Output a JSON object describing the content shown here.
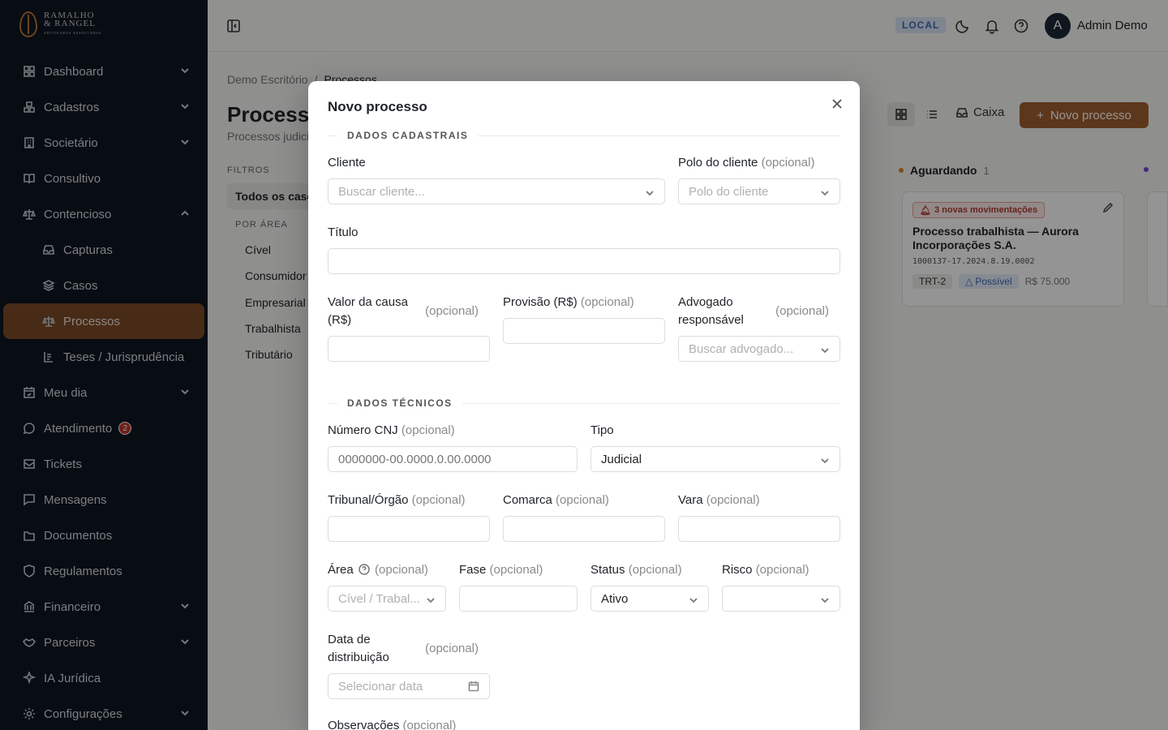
{
  "brand": {
    "name_line1": "RAMALHO",
    "name_line2": "& RANGEL",
    "tagline": "ADVOGADOS ASSOCIADOS"
  },
  "sidebar": {
    "items": [
      {
        "label": "Dashboard"
      },
      {
        "label": "Cadastros"
      },
      {
        "label": "Societário"
      },
      {
        "label": "Consultivo"
      },
      {
        "label": "Contencioso"
      },
      {
        "label": "Capturas"
      },
      {
        "label": "Casos"
      },
      {
        "label": "Processos"
      },
      {
        "label": "Teses / Jurisprudência"
      },
      {
        "label": "Meu dia"
      },
      {
        "label": "Atendimento",
        "badge": "2"
      },
      {
        "label": "Tickets"
      },
      {
        "label": "Mensagens"
      },
      {
        "label": "Documentos"
      },
      {
        "label": "Regulamentos"
      },
      {
        "label": "Financeiro"
      },
      {
        "label": "Parceiros"
      },
      {
        "label": "IA Jurídica"
      },
      {
        "label": "Configurações"
      }
    ]
  },
  "header": {
    "env": "LOCAL",
    "avatar_initial": "A",
    "user_name": "Admin Demo"
  },
  "page": {
    "breadcrumb": [
      "Demo Escritório",
      "Processos"
    ],
    "breadcrumb_sep": "/",
    "title": "Processos",
    "subtitle": "Processos judiciais",
    "filters_label": "FILTROS",
    "filter_all": "Todos os casos",
    "area_label": "POR ÁREA",
    "areas": [
      "Cível",
      "Consumidor",
      "Empresarial",
      "Trabalhista",
      "Tributário"
    ],
    "inbox_label": "Caixa",
    "new_label": "Novo processo"
  },
  "kanban": {
    "column": "Aguardando",
    "count": "1",
    "card": {
      "movements": "3 novas movimentações",
      "title": "Processo trabalhista — Aurora Incorporações S.A.",
      "number": "1000137-17.2024.8.19.0002",
      "court": "TRT-2",
      "risk": "Possível",
      "value": "R$ 75.000"
    }
  },
  "modal": {
    "title": "Novo processo",
    "section_cadastrais": "DADOS CADASTRAIS",
    "section_tecnicos": "DADOS TÉCNICOS",
    "optional": "(opcional)",
    "fields": {
      "cliente": {
        "label": "Cliente",
        "placeholder": "Buscar cliente..."
      },
      "polo": {
        "label": "Polo do cliente",
        "placeholder": "Polo do cliente"
      },
      "titulo": {
        "label": "Título",
        "value": ""
      },
      "valor": {
        "label": "Valor da causa (R$)",
        "value": ""
      },
      "provisao": {
        "label": "Provisão (R$)",
        "value": ""
      },
      "advogado": {
        "label": "Advogado responsável",
        "placeholder": "Buscar advogado..."
      },
      "cnj": {
        "label": "Número CNJ",
        "placeholder": "0000000-00.0000.0.00.0000"
      },
      "tipo": {
        "label": "Tipo",
        "value": "Judicial"
      },
      "tribunal": {
        "label": "Tribunal/Órgão",
        "value": ""
      },
      "comarca": {
        "label": "Comarca",
        "value": ""
      },
      "vara": {
        "label": "Vara",
        "value": ""
      },
      "area": {
        "label": "Área",
        "placeholder": "Cível / Trabal..."
      },
      "fase": {
        "label": "Fase",
        "value": ""
      },
      "status": {
        "label": "Status",
        "value": "Ativo"
      },
      "risco": {
        "label": "Risco",
        "value": ""
      },
      "data": {
        "label": "Data de distribuição",
        "placeholder": "Selecionar data"
      },
      "obs": {
        "label": "Observações"
      }
    }
  },
  "colors": {
    "sidebar_bg": "#0f1622",
    "active_item": "#7a4a27",
    "primary_button": "#a0602f",
    "env_badge": "#3d6bb3",
    "danger": "#b23b33"
  }
}
